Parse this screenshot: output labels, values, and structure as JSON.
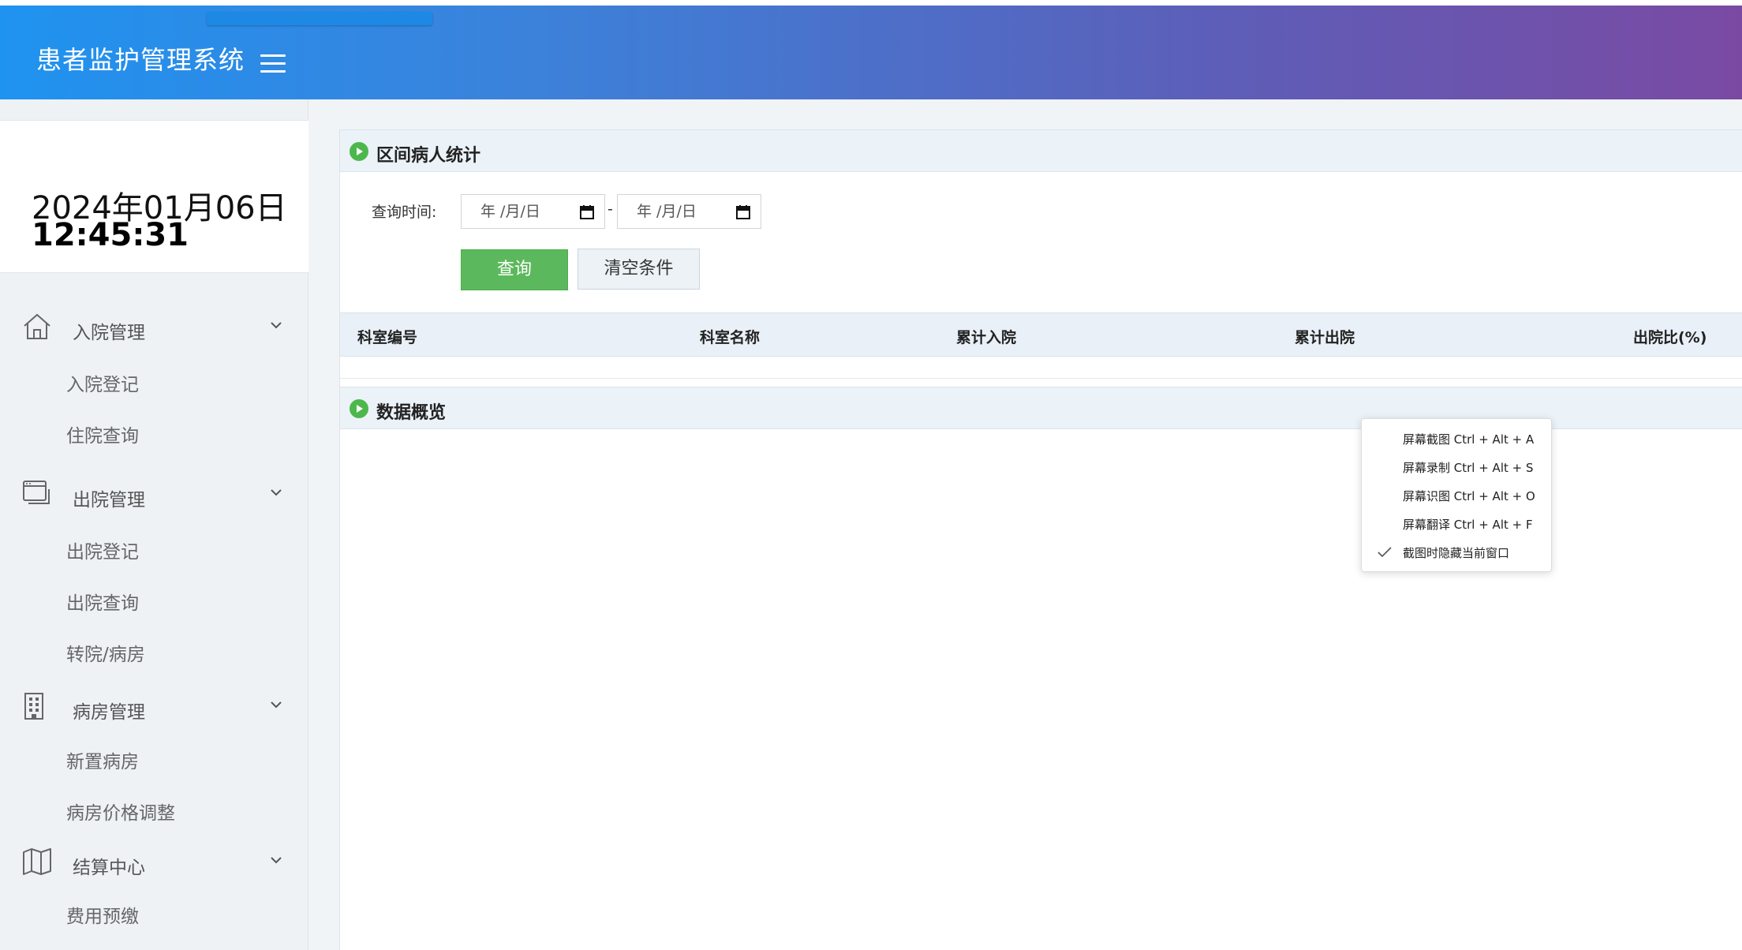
{
  "header": {
    "title": "患者监护管理系统",
    "menu_icon": "hamburger-menu-icon"
  },
  "clock": {
    "date": "2024年01月06日",
    "time": "12:45:31"
  },
  "sidebar": {
    "groups": [
      {
        "label": "入院管理",
        "icon": "home-icon",
        "items": [
          "入院登记",
          "住院查询"
        ]
      },
      {
        "label": "出院管理",
        "icon": "window-stack-icon",
        "items": [
          "出院登记",
          "出院查询",
          "转院/病房"
        ]
      },
      {
        "label": "病房管理",
        "icon": "building-icon",
        "items": [
          "新置病房",
          "病房价格调整"
        ]
      },
      {
        "label": "结算中心",
        "icon": "map-icon",
        "items": [
          "费用预缴"
        ]
      }
    ]
  },
  "stats_section": {
    "title": "区间病人统计",
    "query_label": "查询时间:",
    "date_placeholder": "年 /月/日",
    "date_separator": "-",
    "query_button": "查询",
    "clear_button": "清空条件",
    "columns": [
      "科室编号",
      "科室名称",
      "累计入院",
      "累计出院",
      "出院比(%)"
    ]
  },
  "overview_section": {
    "title": "数据概览"
  },
  "context_menu": {
    "items": [
      "屏幕截图 Ctrl + Alt + A",
      "屏幕录制 Ctrl + Alt + S",
      "屏幕识图 Ctrl + Alt + O",
      "屏幕翻译 Ctrl + Alt + F",
      "截图时隐藏当前窗口"
    ]
  },
  "colors": {
    "header_start": "#1f93f0",
    "header_end": "#7a4aa3",
    "query_button": "#5cb85c",
    "section_icon": "#4cb84c"
  }
}
